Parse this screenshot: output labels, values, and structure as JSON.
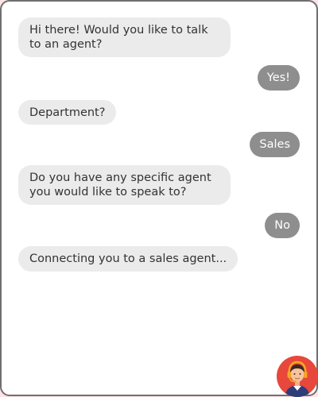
{
  "chat": {
    "messages": [
      {
        "sender": "bot",
        "text": "Hi there! Would you like to talk to an agent?"
      },
      {
        "sender": "user",
        "text": "Yes!"
      },
      {
        "sender": "bot",
        "text": "Department?"
      },
      {
        "sender": "user",
        "text": "Sales"
      },
      {
        "sender": "bot",
        "text": "Do you have any specific agent you would like to speak to?"
      },
      {
        "sender": "user",
        "text": "No"
      },
      {
        "sender": "bot",
        "text": "Connecting you to a sales agent..."
      }
    ]
  },
  "avatar": {
    "icon": "support-agent-icon",
    "background_color": "#e8473b"
  },
  "colors": {
    "bot_bubble": "#ebebeb",
    "user_bubble": "#8e8e8e",
    "page_background": "#ffe4e6",
    "window_border": "#6f6f6f"
  }
}
